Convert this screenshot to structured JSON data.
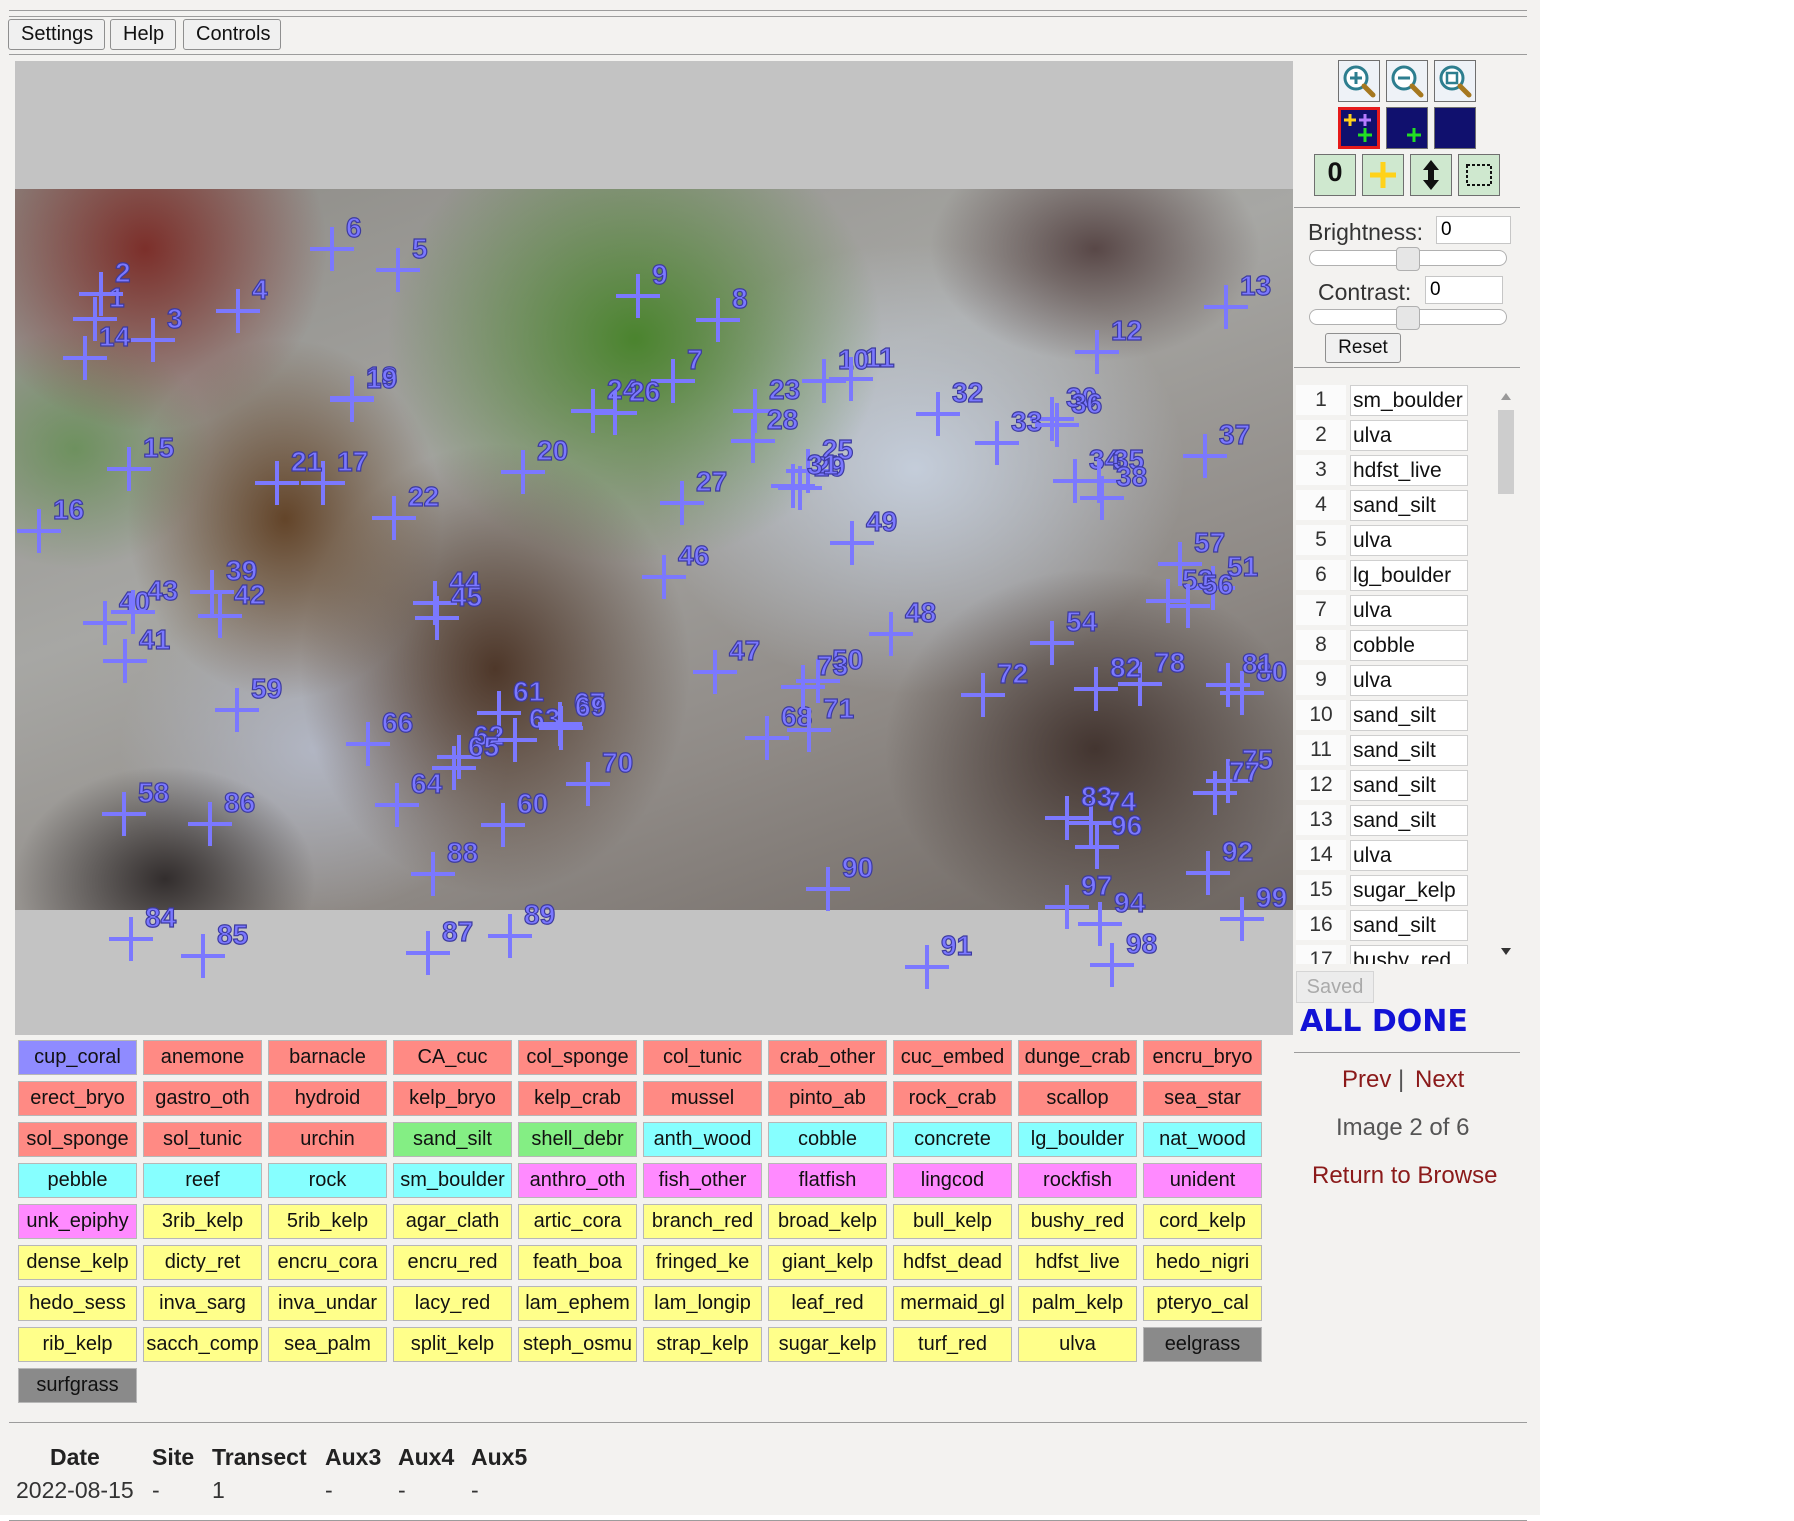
{
  "toolbar": {
    "settings": "Settings",
    "help": "Help",
    "controls": "Controls"
  },
  "overlay": {
    "marker_color": "#7b78ff",
    "markers": [
      "1",
      "2",
      "3",
      "4",
      "5",
      "6",
      "7",
      "8",
      "9",
      "10",
      "11",
      "12",
      "13",
      "14",
      "15",
      "16",
      "17",
      "18",
      "19",
      "20",
      "21",
      "22",
      "23",
      "24",
      "25",
      "26",
      "27",
      "28",
      "29",
      "30",
      "31",
      "32",
      "33",
      "34",
      "35",
      "36",
      "37",
      "38",
      "39",
      "40",
      "41",
      "42",
      "43",
      "44",
      "45",
      "46",
      "47",
      "48",
      "49",
      "50",
      "51",
      "53",
      "54",
      "56",
      "57",
      "58",
      "59",
      "60",
      "61",
      "62",
      "63",
      "64",
      "65",
      "66",
      "67",
      "68",
      "69",
      "70",
      "71",
      "72",
      "73",
      "74",
      "75",
      "77",
      "78",
      "80",
      "81",
      "82",
      "83",
      "84",
      "85",
      "86",
      "87",
      "88",
      "89",
      "90",
      "91",
      "92",
      "94",
      "96",
      "97",
      "98",
      "99"
    ]
  },
  "tools": {
    "zoom_in": "zoom-in-icon",
    "zoom_out": "zoom-out-icon",
    "zoom_fit": "zoom-fit-icon",
    "marker_all": "all-markers-icon",
    "marker_current": "current-marker-icon",
    "marker_none": "no-markers-icon",
    "zero_label": "0",
    "add_point": "plus-icon",
    "move_point": "up-down-arrow-icon",
    "select_rect": "dashed-rectangle-icon"
  },
  "adjust": {
    "brightness_label": "Brightness:",
    "brightness_value": "0",
    "contrast_label": "Contrast:",
    "contrast_value": "0",
    "reset": "Reset"
  },
  "points": [
    {
      "num": "1",
      "label": "sm_boulder"
    },
    {
      "num": "2",
      "label": "ulva"
    },
    {
      "num": "3",
      "label": "hdfst_live"
    },
    {
      "num": "4",
      "label": "sand_silt"
    },
    {
      "num": "5",
      "label": "ulva"
    },
    {
      "num": "6",
      "label": "lg_boulder"
    },
    {
      "num": "7",
      "label": "ulva"
    },
    {
      "num": "8",
      "label": "cobble"
    },
    {
      "num": "9",
      "label": "ulva"
    },
    {
      "num": "10",
      "label": "sand_silt"
    },
    {
      "num": "11",
      "label": "sand_silt"
    },
    {
      "num": "12",
      "label": "sand_silt"
    },
    {
      "num": "13",
      "label": "sand_silt"
    },
    {
      "num": "14",
      "label": "ulva"
    },
    {
      "num": "15",
      "label": "sugar_kelp"
    },
    {
      "num": "16",
      "label": "sand_silt"
    },
    {
      "num": "17",
      "label": "bushy_red"
    }
  ],
  "status": {
    "saved": "Saved",
    "all_done": "ALL DONE"
  },
  "nav": {
    "prev": "Prev",
    "separator": "|",
    "next": "Next",
    "image_info": "Image 2 of 6",
    "return": "Return to Browse"
  },
  "palette": {
    "colors": {
      "blue": "#8f8bff",
      "red": "#ff8a84",
      "green": "#84ee84",
      "cyan": "#86ffff",
      "magenta": "#ff8aff",
      "yellow": "#ffff8a",
      "gray": "#8a8a8a"
    },
    "labels": [
      {
        "text": "cup_coral",
        "color": "blue"
      },
      {
        "text": "anemone",
        "color": "red"
      },
      {
        "text": "barnacle",
        "color": "red"
      },
      {
        "text": "CA_cuc",
        "color": "red"
      },
      {
        "text": "col_sponge",
        "color": "red"
      },
      {
        "text": "col_tunic",
        "color": "red"
      },
      {
        "text": "crab_other",
        "color": "red"
      },
      {
        "text": "cuc_embed",
        "color": "red"
      },
      {
        "text": "dunge_crab",
        "color": "red"
      },
      {
        "text": "encru_bryo",
        "color": "red"
      },
      {
        "text": "erect_bryo",
        "color": "red"
      },
      {
        "text": "gastro_oth",
        "color": "red"
      },
      {
        "text": "hydroid",
        "color": "red"
      },
      {
        "text": "kelp_bryo",
        "color": "red"
      },
      {
        "text": "kelp_crab",
        "color": "red"
      },
      {
        "text": "mussel",
        "color": "red"
      },
      {
        "text": "pinto_ab",
        "color": "red"
      },
      {
        "text": "rock_crab",
        "color": "red"
      },
      {
        "text": "scallop",
        "color": "red"
      },
      {
        "text": "sea_star",
        "color": "red"
      },
      {
        "text": "sol_sponge",
        "color": "red"
      },
      {
        "text": "sol_tunic",
        "color": "red"
      },
      {
        "text": "urchin",
        "color": "red"
      },
      {
        "text": "sand_silt",
        "color": "green"
      },
      {
        "text": "shell_debr",
        "color": "green"
      },
      {
        "text": "anth_wood",
        "color": "cyan"
      },
      {
        "text": "cobble",
        "color": "cyan"
      },
      {
        "text": "concrete",
        "color": "cyan"
      },
      {
        "text": "lg_boulder",
        "color": "cyan"
      },
      {
        "text": "nat_wood",
        "color": "cyan"
      },
      {
        "text": "pebble",
        "color": "cyan"
      },
      {
        "text": "reef",
        "color": "cyan"
      },
      {
        "text": "rock",
        "color": "cyan"
      },
      {
        "text": "sm_boulder",
        "color": "cyan"
      },
      {
        "text": "anthro_oth",
        "color": "magenta"
      },
      {
        "text": "fish_other",
        "color": "magenta"
      },
      {
        "text": "flatfish",
        "color": "magenta"
      },
      {
        "text": "lingcod",
        "color": "magenta"
      },
      {
        "text": "rockfish",
        "color": "magenta"
      },
      {
        "text": "unident",
        "color": "magenta"
      },
      {
        "text": "unk_epiphy",
        "color": "magenta"
      },
      {
        "text": "3rib_kelp",
        "color": "yellow"
      },
      {
        "text": "5rib_kelp",
        "color": "yellow"
      },
      {
        "text": "agar_clath",
        "color": "yellow"
      },
      {
        "text": "artic_cora",
        "color": "yellow"
      },
      {
        "text": "branch_red",
        "color": "yellow"
      },
      {
        "text": "broad_kelp",
        "color": "yellow"
      },
      {
        "text": "bull_kelp",
        "color": "yellow"
      },
      {
        "text": "bushy_red",
        "color": "yellow"
      },
      {
        "text": "cord_kelp",
        "color": "yellow"
      },
      {
        "text": "dense_kelp",
        "color": "yellow"
      },
      {
        "text": "dicty_ret",
        "color": "yellow"
      },
      {
        "text": "encru_cora",
        "color": "yellow"
      },
      {
        "text": "encru_red",
        "color": "yellow"
      },
      {
        "text": "feath_boa",
        "color": "yellow"
      },
      {
        "text": "fringed_ke",
        "color": "yellow"
      },
      {
        "text": "giant_kelp",
        "color": "yellow"
      },
      {
        "text": "hdfst_dead",
        "color": "yellow"
      },
      {
        "text": "hdfst_live",
        "color": "yellow"
      },
      {
        "text": "hedo_nigri",
        "color": "yellow"
      },
      {
        "text": "hedo_sess",
        "color": "yellow"
      },
      {
        "text": "inva_sarg",
        "color": "yellow"
      },
      {
        "text": "inva_undar",
        "color": "yellow"
      },
      {
        "text": "lacy_red",
        "color": "yellow"
      },
      {
        "text": "lam_ephem",
        "color": "yellow"
      },
      {
        "text": "lam_longip",
        "color": "yellow"
      },
      {
        "text": "leaf_red",
        "color": "yellow"
      },
      {
        "text": "mermaid_gl",
        "color": "yellow"
      },
      {
        "text": "palm_kelp",
        "color": "yellow"
      },
      {
        "text": "pteryo_cal",
        "color": "yellow"
      },
      {
        "text": "rib_kelp",
        "color": "yellow"
      },
      {
        "text": "sacch_comp",
        "color": "yellow"
      },
      {
        "text": "sea_palm",
        "color": "yellow"
      },
      {
        "text": "split_kelp",
        "color": "yellow"
      },
      {
        "text": "steph_osmu",
        "color": "yellow"
      },
      {
        "text": "strap_kelp",
        "color": "yellow"
      },
      {
        "text": "sugar_kelp",
        "color": "yellow"
      },
      {
        "text": "turf_red",
        "color": "yellow"
      },
      {
        "text": "ulva",
        "color": "yellow"
      },
      {
        "text": "eelgrass",
        "color": "gray"
      },
      {
        "text": "surfgrass",
        "color": "gray"
      }
    ]
  },
  "meta": {
    "headers": {
      "date": "Date",
      "site": "Site",
      "transect": "Transect",
      "aux3": "Aux3",
      "aux4": "Aux4",
      "aux5": "Aux5"
    },
    "values": {
      "date": "2022-08-15",
      "site": "-",
      "transect": "1",
      "aux3": "-",
      "aux4": "-",
      "aux5": "-"
    }
  }
}
